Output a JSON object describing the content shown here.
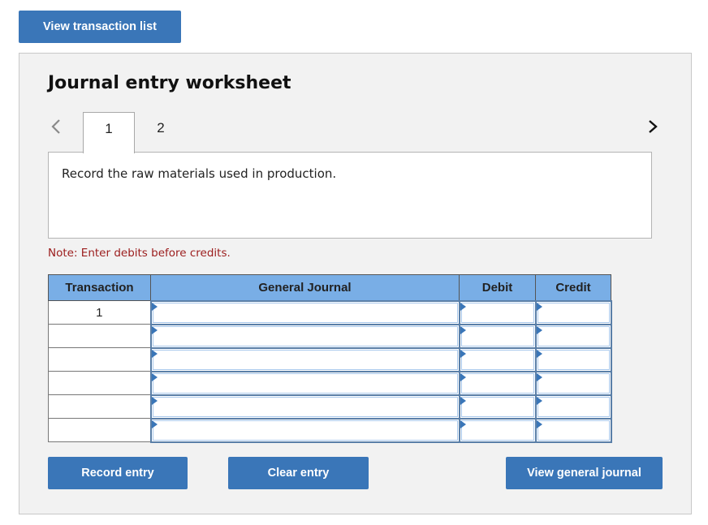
{
  "top_button": {
    "label": "View transaction list"
  },
  "worksheet": {
    "title": "Journal entry worksheet",
    "tabs": [
      {
        "label": "1",
        "active": true
      },
      {
        "label": "2",
        "active": false
      }
    ],
    "prev_icon": "chevron-left-icon",
    "next_icon": "chevron-right-icon",
    "prompt": "Record the raw materials used in production.",
    "note": "Note: Enter debits before credits.",
    "colors": {
      "accent": "#3a76b8",
      "header": "#79aee6",
      "note": "#9b1c1c",
      "panel": "#f2f2f2"
    }
  },
  "table": {
    "headers": [
      "Transaction",
      "General Journal",
      "Debit",
      "Credit"
    ],
    "rows": [
      {
        "transaction": "1",
        "account": "",
        "debit": "",
        "credit": ""
      },
      {
        "transaction": "",
        "account": "",
        "debit": "",
        "credit": ""
      },
      {
        "transaction": "",
        "account": "",
        "debit": "",
        "credit": ""
      },
      {
        "transaction": "",
        "account": "",
        "debit": "",
        "credit": ""
      },
      {
        "transaction": "",
        "account": "",
        "debit": "",
        "credit": ""
      },
      {
        "transaction": "",
        "account": "",
        "debit": "",
        "credit": ""
      }
    ]
  },
  "buttons": {
    "record": "Record entry",
    "clear": "Clear entry",
    "view_general_journal": "View general journal"
  }
}
